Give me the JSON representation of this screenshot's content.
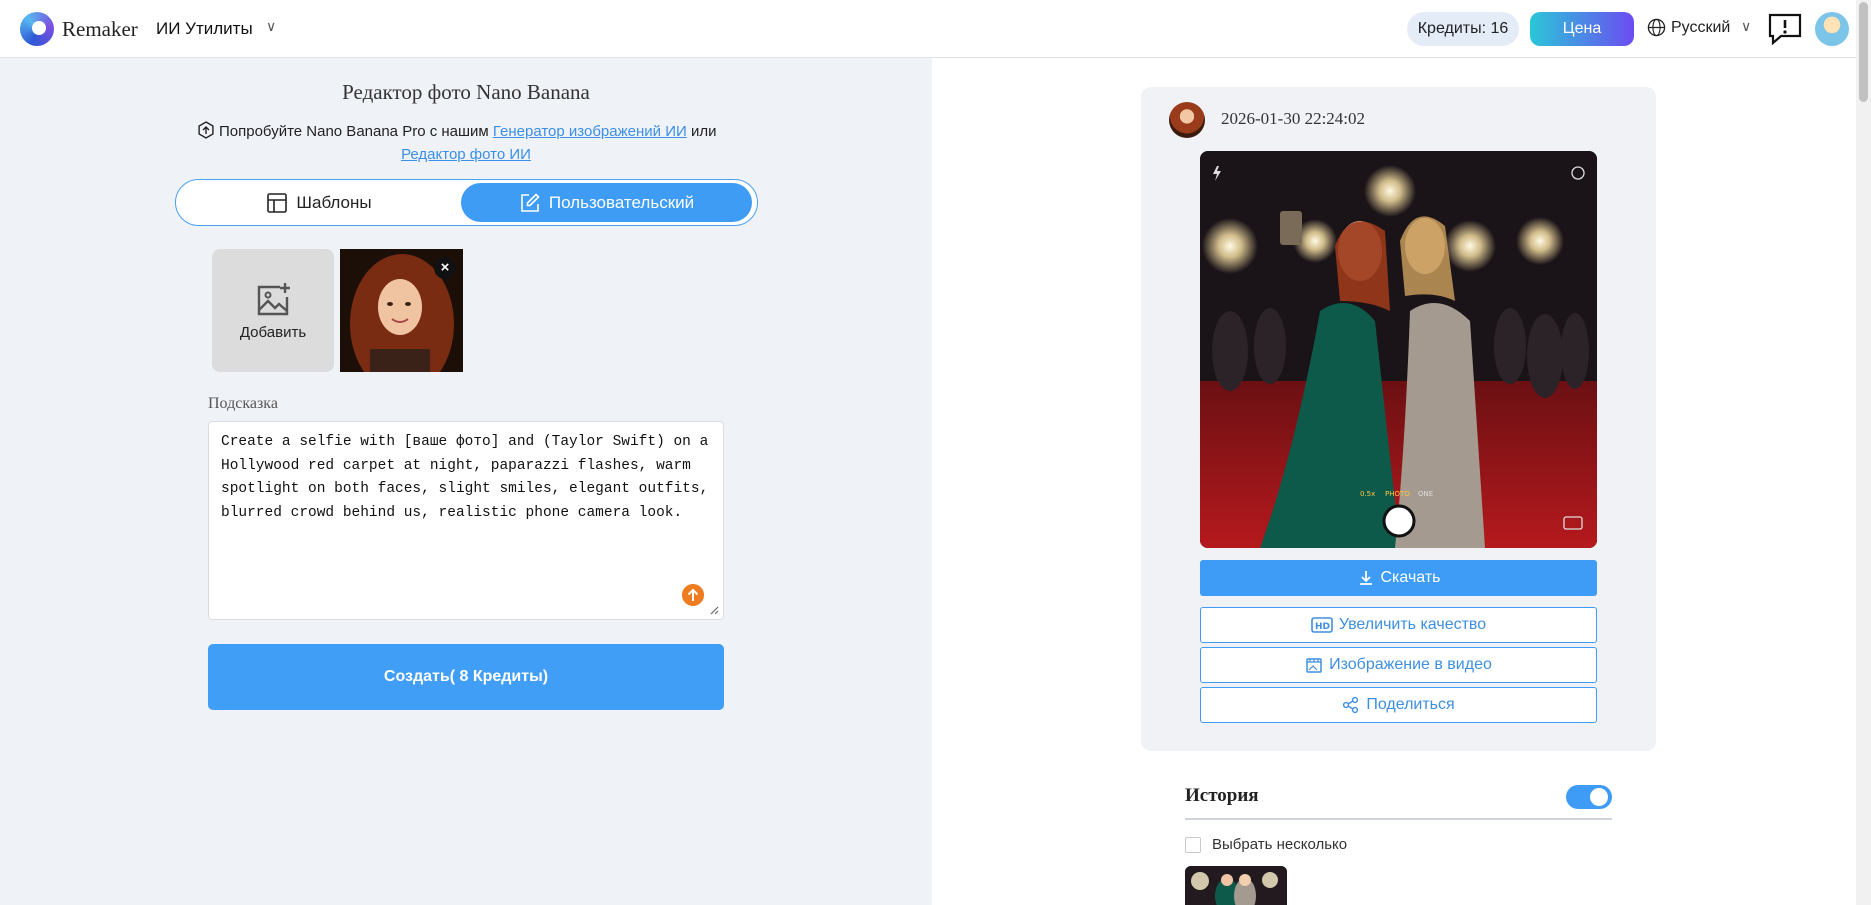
{
  "header": {
    "brand": "Remaker",
    "tools_menu": "ИИ Утилиты",
    "credits": "Кредиты: 16",
    "price_button": "Цена",
    "language": "Русский"
  },
  "editor": {
    "title": "Редактор фото Nano Banana",
    "promo_prefix": "Попробуйте Nano Banana Pro с нашим",
    "promo_link1": "Генератор изображений ИИ",
    "promo_mid": "или",
    "promo_link2": "Редактор фото ИИ",
    "tabs": [
      {
        "label": "Шаблоны",
        "active": false
      },
      {
        "label": "Пользовательский",
        "active": true
      }
    ],
    "add_label": "Добавить",
    "prompt_label": "Подсказка",
    "prompt_value": "Create a selfie with [ваше фото] and (Taylor Swift) on a Hollywood red carpet at night, paparazzi flashes, warm spotlight on both faces, slight smiles, elegant outfits, blurred crowd behind us, realistic phone camera look.",
    "create_button": "Создать( 8 Кредиты)"
  },
  "result": {
    "timestamp": "2026-01-30 22:24:02",
    "camera_modes": [
      "0.5x",
      "PHOTO",
      "ONE"
    ],
    "download": "Скачать",
    "upscale": "Увеличить качество",
    "to_video": "Изображение в видео",
    "share": "Поделиться"
  },
  "history": {
    "title": "История",
    "toggle_on": true,
    "select_multiple": "Выбрать несколько"
  },
  "colors": {
    "accent": "#3e9cf6",
    "panel_bg": "#eff2f7",
    "price_gradient_start": "#2bc6d8",
    "price_gradient_end": "#6c4cf2",
    "upload_badge": "#ee7d22"
  }
}
